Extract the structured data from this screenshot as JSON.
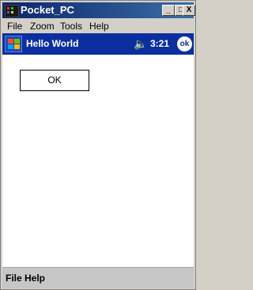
{
  "window": {
    "title": "Pocket_PC",
    "minimize_label": "_",
    "maximize_label": "□",
    "close_label": "X"
  },
  "menubar": {
    "items": [
      "File",
      "Zoom",
      "Tools",
      "Help"
    ]
  },
  "navbar": {
    "title": "Hello World",
    "speaker_glyph": "🔈",
    "time": "3:21",
    "ok_label": "ok",
    "color": "#0b2f9e"
  },
  "content": {
    "button_label": "OK"
  },
  "softbar": {
    "items": [
      "File",
      "Help"
    ]
  }
}
